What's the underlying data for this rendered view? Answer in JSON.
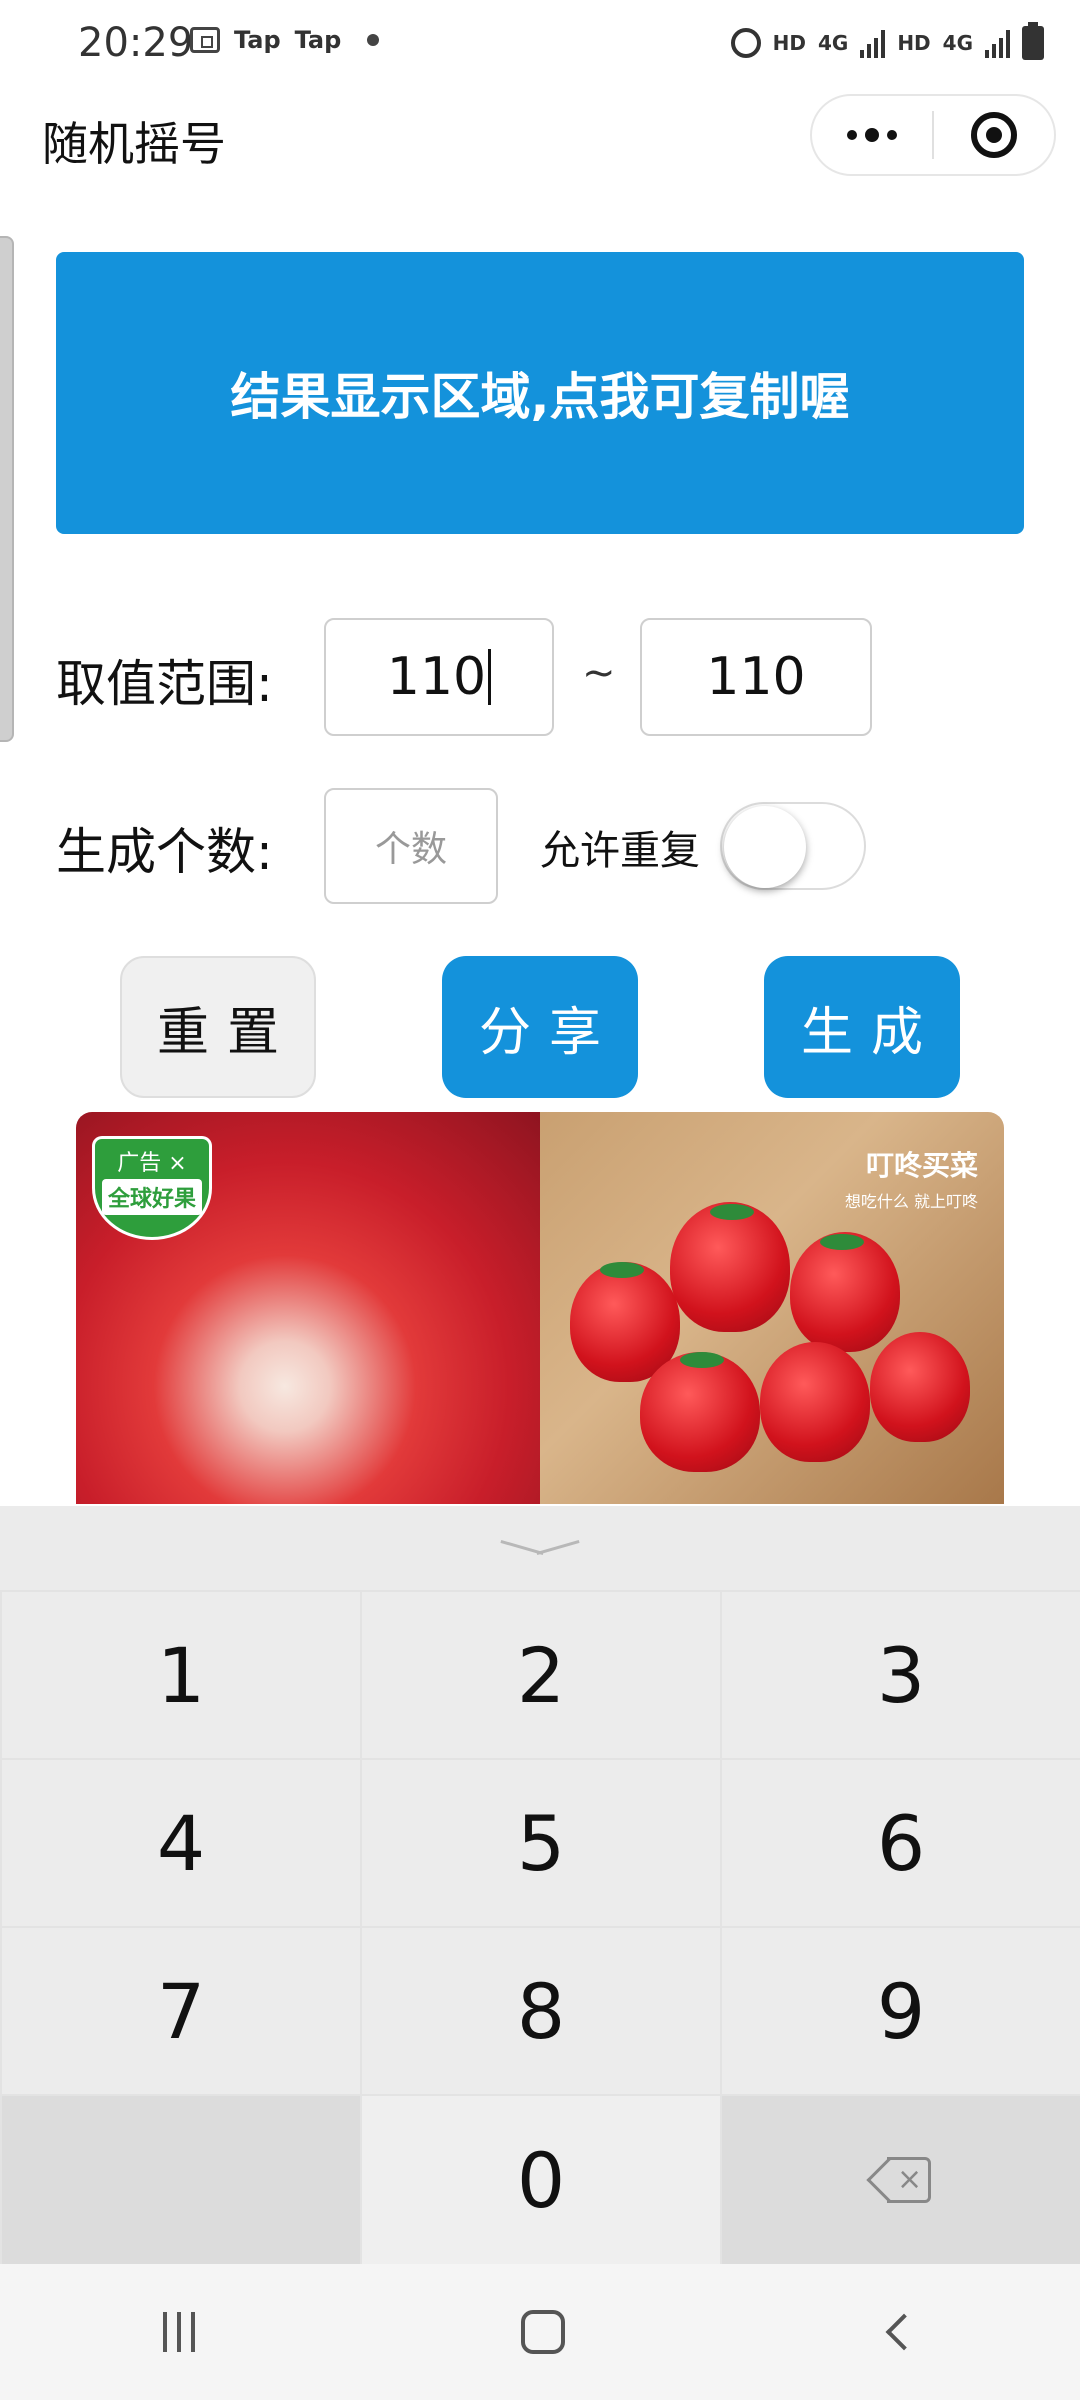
{
  "status_bar": {
    "time": "20:29",
    "app_labels": [
      "Tap",
      "Tap"
    ],
    "right_labels": [
      "HD",
      "4G",
      "HD",
      "4G"
    ]
  },
  "header": {
    "title": "随机摇号"
  },
  "result": {
    "text": "结果显示区域,点我可复制喔"
  },
  "range": {
    "label": "取值范围:",
    "min_value": "110",
    "separator": "~",
    "max_value": "110"
  },
  "count": {
    "label": "生成个数:",
    "placeholder": "个数",
    "allow_repeat_label": "允许重复",
    "allow_repeat": false
  },
  "buttons": {
    "reset": "重置",
    "share": "分享",
    "generate": "生成"
  },
  "ad": {
    "tag": "广告 ×",
    "brand_left": "全球好果",
    "brand_right": "叮咚买菜",
    "slogan": "想吃什么 就上叮咚"
  },
  "keyboard": {
    "keys": [
      "1",
      "2",
      "3",
      "4",
      "5",
      "6",
      "7",
      "8",
      "9",
      "",
      "0"
    ]
  },
  "colors": {
    "accent": "#1492db",
    "keyboard_bg": "#ebebeb"
  }
}
